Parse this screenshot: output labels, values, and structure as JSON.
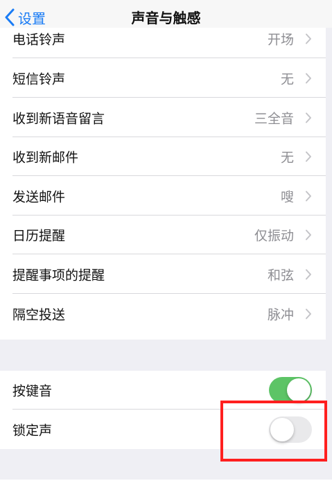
{
  "nav": {
    "back_label": "设置",
    "title": "声音与触感"
  },
  "sounds": [
    {
      "label": "电话铃声",
      "value": "开场"
    },
    {
      "label": "短信铃声",
      "value": "无"
    },
    {
      "label": "收到新语音留言",
      "value": "三全音"
    },
    {
      "label": "收到新邮件",
      "value": "无"
    },
    {
      "label": "发送邮件",
      "value": "嗖"
    },
    {
      "label": "日历提醒",
      "value": "仅振动"
    },
    {
      "label": "提醒事项的提醒",
      "value": "和弦"
    },
    {
      "label": "隔空投送",
      "value": "脉冲"
    }
  ],
  "toggles": [
    {
      "label": "按键音",
      "on": true
    },
    {
      "label": "锁定声",
      "on": false
    }
  ],
  "colors": {
    "accent": "#1a7cf5",
    "toggle_on": "#5dc466",
    "highlight": "#ff1f1f"
  }
}
